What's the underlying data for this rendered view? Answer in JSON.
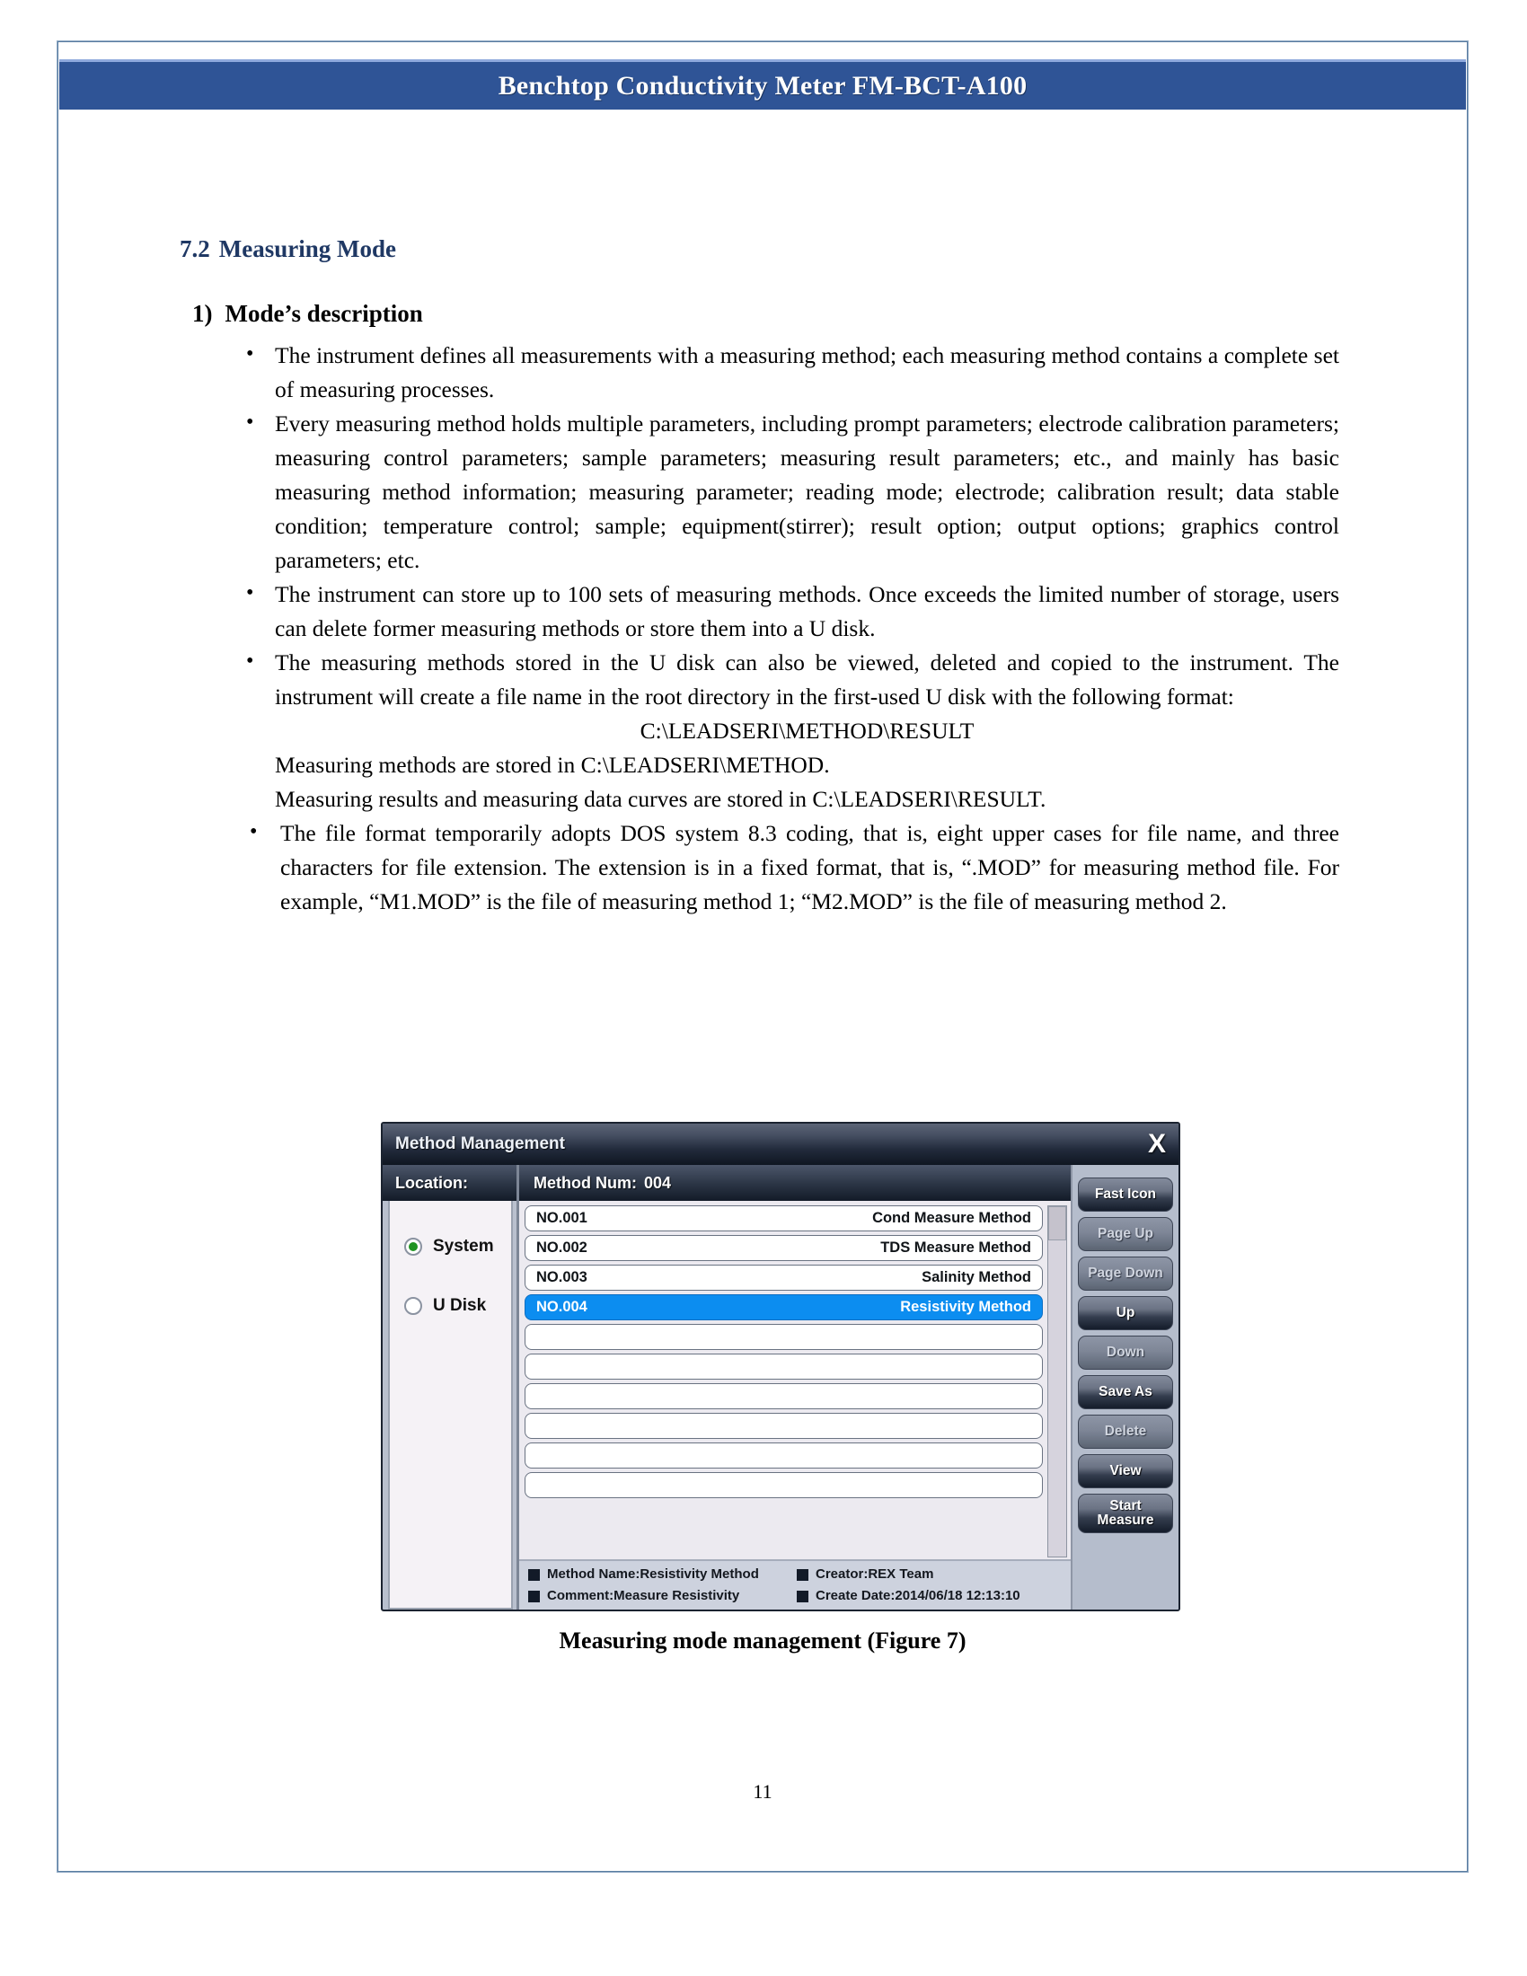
{
  "header": {
    "title": "Benchtop Conductivity Meter FM-BCT-A100",
    "band_color": "#2f5496"
  },
  "section": {
    "number": "7.2",
    "title": "Measuring Mode",
    "color": "#1f3864"
  },
  "subsection": {
    "number": "1)",
    "title": "Mode’s description"
  },
  "bullets": [
    "The instrument defines all measurements with a measuring method; each measuring method contains a complete set of measuring processes.",
    "Every measuring method holds multiple parameters, including prompt parameters; electrode calibration parameters; measuring control parameters; sample parameters; measuring result parameters; etc., and mainly has basic measuring method information; measuring parameter; reading mode; electrode; calibration result; data stable condition; temperature control; sample; equipment(stirrer); result option; output options; graphics control parameters; etc.",
    "The instrument can store up to 100 sets of measuring methods. Once exceeds the limited number of storage, users can delete former measuring methods or store them into a U disk.",
    "The measuring methods stored in the U disk can also be viewed, deleted and copied to the instrument. The instrument will create a file name in the root directory in the first-used U disk with the following format:",
    "The file format temporarily adopts DOS system 8.3 coding, that is, eight upper cases for file name, and three characters for file extension. The extension is in a fixed format, that is, “.MOD” for measuring method file. For example, “M1.MOD” is the file of measuring method 1; “M2.MOD” is the file of measuring method 2."
  ],
  "paths": {
    "centered": "C:\\LEADSERI\\METHOD\\RESULT",
    "line1": "Measuring methods are stored in C:\\LEADSERI\\METHOD.",
    "line2": "Measuring results and measuring data curves are stored in C:\\LEADSERI\\RESULT."
  },
  "figure": {
    "caption": "Measuring mode management (Figure 7)",
    "dialog": {
      "title": "Method Management",
      "close_label": "X",
      "location": {
        "header": "Location:",
        "options": [
          {
            "label": "System",
            "selected": true
          },
          {
            "label": "U Disk",
            "selected": false
          }
        ],
        "radio_on_color": "#1f9321"
      },
      "method_header_label": "Method Num:",
      "method_count": "004",
      "methods": [
        {
          "no": "NO.001",
          "name": "Cond Measure Method",
          "selected": false
        },
        {
          "no": "NO.002",
          "name": "TDS Measure Method",
          "selected": false
        },
        {
          "no": "NO.003",
          "name": "Salinity Method",
          "selected": false
        },
        {
          "no": "NO.004",
          "name": "Resistivity Method",
          "selected": true
        },
        {
          "no": "",
          "name": "",
          "selected": false
        },
        {
          "no": "",
          "name": "",
          "selected": false
        },
        {
          "no": "",
          "name": "",
          "selected": false
        },
        {
          "no": "",
          "name": "",
          "selected": false
        },
        {
          "no": "",
          "name": "",
          "selected": false
        },
        {
          "no": "",
          "name": "",
          "selected": false
        }
      ],
      "selection_color": "#0c8df0",
      "info": [
        "Method Name:Resistivity Method",
        "Creator:REX Team",
        "Comment:Measure Resistivity",
        "Create Date:2014/06/18 12:13:10"
      ],
      "buttons": [
        {
          "label": "Fast Icon",
          "enabled": true
        },
        {
          "label": "Page Up",
          "enabled": false
        },
        {
          "label": "Page Down",
          "enabled": false
        },
        {
          "label": "Up",
          "enabled": true
        },
        {
          "label": "Down",
          "enabled": false
        },
        {
          "label": "Save As",
          "enabled": true
        },
        {
          "label": "Delete",
          "enabled": false
        },
        {
          "label": "View",
          "enabled": true
        },
        {
          "label": "Start\nMeasure",
          "enabled": true
        }
      ]
    }
  },
  "page_number": "11"
}
